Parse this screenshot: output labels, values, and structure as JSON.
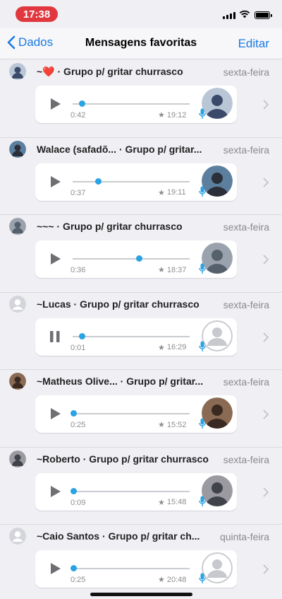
{
  "status_bar": {
    "time": "17:38"
  },
  "nav": {
    "back_label": "Dados",
    "title": "Mensagens favoritas",
    "edit_label": "Editar"
  },
  "colors": {
    "accent": "#1a7ae2",
    "progress": "#2aa3e4",
    "time_pill": "#e0383e"
  },
  "messages": [
    {
      "sender": "~❤️ · Grupo p/ gritar churrasco",
      "date": "sexta-feira",
      "duration": "0:42",
      "time": "19:12",
      "progress": 0.08,
      "state": "play"
    },
    {
      "sender": "Walace (safadõ... · Grupo p/ gritar...",
      "date": "sexta-feira",
      "duration": "0:37",
      "time": "19:11",
      "progress": 0.22,
      "state": "play"
    },
    {
      "sender": "~~~ · Grupo p/ gritar churrasco",
      "date": "sexta-feira",
      "duration": "0:36",
      "time": "18:37",
      "progress": 0.57,
      "state": "play"
    },
    {
      "sender": "~Lucas · Grupo p/ gritar churrasco",
      "date": "sexta-feira",
      "duration": "0:01",
      "time": "16:29",
      "progress": 0.08,
      "state": "pause"
    },
    {
      "sender": "~Matheus Olive... · Grupo p/ gritar...",
      "date": "sexta-feira",
      "duration": "0:25",
      "time": "15:52",
      "progress": 0.01,
      "state": "play"
    },
    {
      "sender": "~Roberto · Grupo p/ gritar churrasco",
      "date": "sexta-feira",
      "duration": "0:09",
      "time": "15:48",
      "progress": 0.01,
      "state": "play"
    },
    {
      "sender": "~Caio Santos · Grupo p/ gritar ch...",
      "date": "quinta-feira",
      "duration": "0:25",
      "time": "20:48",
      "progress": 0.01,
      "state": "play"
    }
  ]
}
